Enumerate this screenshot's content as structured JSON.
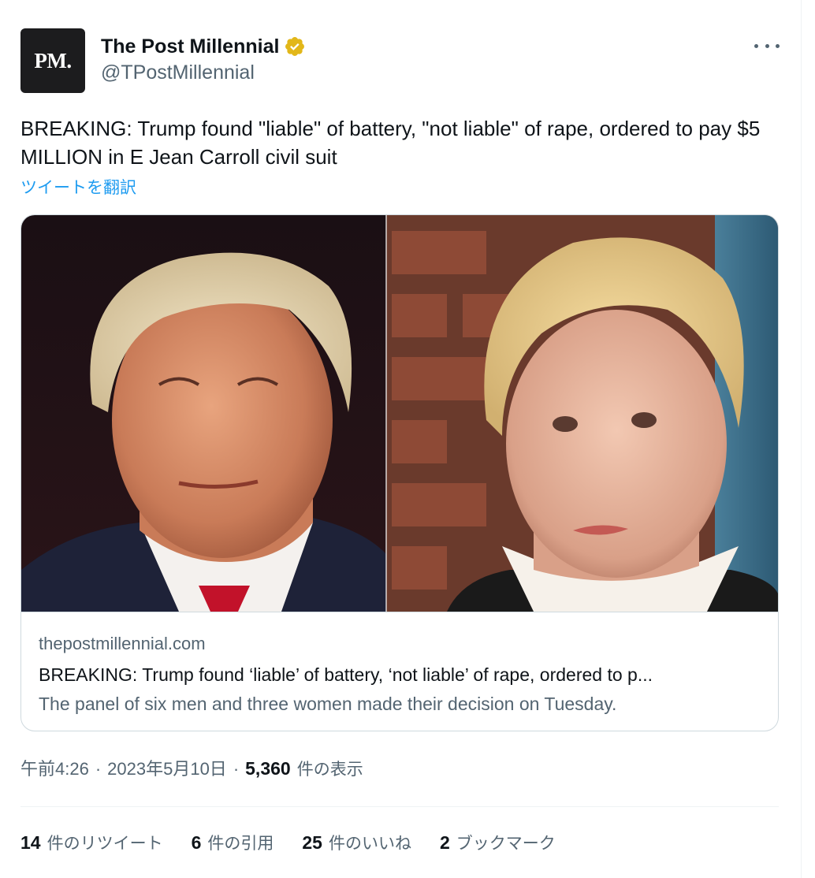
{
  "account": {
    "avatar_text": "PM.",
    "display_name": "The Post Millennial",
    "handle": "@TPostMillennial"
  },
  "tweet": {
    "text": "BREAKING: Trump found \"liable\" of battery, \"not liable\" of rape, ordered to pay $5 MILLION in E Jean Carroll civil suit",
    "translate_label": "ツイートを翻訳"
  },
  "card": {
    "domain": "thepostmillennial.com",
    "title": "BREAKING: Trump found ‘liable’ of battery, ‘not liable’ of rape, ordered to p...",
    "description": "The panel of six men and three women made their decision on Tuesday."
  },
  "meta": {
    "time": "午前4:26",
    "date": "2023年5月10日",
    "separator": "·",
    "views_count": "5,360",
    "views_label": "件の表示"
  },
  "stats": [
    {
      "num": "14",
      "label": "件のリツイート"
    },
    {
      "num": "6",
      "label": "件の引用"
    },
    {
      "num": "25",
      "label": "件のいいね"
    },
    {
      "num": "2",
      "label": "ブックマーク"
    }
  ],
  "colors": {
    "accent": "#1d9bf0",
    "verified_gold": "#e2b719",
    "text_primary": "#0f1419",
    "text_secondary": "#536471",
    "border": "#cfd9de"
  },
  "icons": {
    "verified": "verified-gold-badge-icon",
    "more": "more-horizontal-icon"
  }
}
